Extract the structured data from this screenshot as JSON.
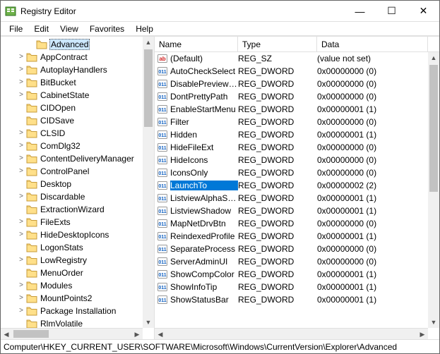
{
  "window": {
    "title": "Registry Editor"
  },
  "menu": {
    "file": "File",
    "edit": "Edit",
    "view": "View",
    "favorites": "Favorites",
    "help": "Help"
  },
  "tree": {
    "items": [
      {
        "indent": 2,
        "twist": "",
        "label": "Advanced",
        "selected": true
      },
      {
        "indent": 1,
        "twist": ">",
        "label": "AppContract"
      },
      {
        "indent": 1,
        "twist": ">",
        "label": "AutoplayHandlers"
      },
      {
        "indent": 1,
        "twist": ">",
        "label": "BitBucket"
      },
      {
        "indent": 1,
        "twist": ">",
        "label": "CabinetState"
      },
      {
        "indent": 1,
        "twist": "",
        "label": "CIDOpen"
      },
      {
        "indent": 1,
        "twist": "",
        "label": "CIDSave"
      },
      {
        "indent": 1,
        "twist": ">",
        "label": "CLSID"
      },
      {
        "indent": 1,
        "twist": ">",
        "label": "ComDlg32"
      },
      {
        "indent": 1,
        "twist": ">",
        "label": "ContentDeliveryManager"
      },
      {
        "indent": 1,
        "twist": ">",
        "label": "ControlPanel"
      },
      {
        "indent": 1,
        "twist": "",
        "label": "Desktop"
      },
      {
        "indent": 1,
        "twist": ">",
        "label": "Discardable"
      },
      {
        "indent": 1,
        "twist": "",
        "label": "ExtractionWizard"
      },
      {
        "indent": 1,
        "twist": ">",
        "label": "FileExts"
      },
      {
        "indent": 1,
        "twist": ">",
        "label": "HideDesktopIcons"
      },
      {
        "indent": 1,
        "twist": "",
        "label": "LogonStats"
      },
      {
        "indent": 1,
        "twist": ">",
        "label": "LowRegistry"
      },
      {
        "indent": 1,
        "twist": "",
        "label": "MenuOrder"
      },
      {
        "indent": 1,
        "twist": ">",
        "label": "Modules"
      },
      {
        "indent": 1,
        "twist": ">",
        "label": "MountPoints2"
      },
      {
        "indent": 1,
        "twist": ">",
        "label": "Package Installation"
      },
      {
        "indent": 1,
        "twist": "",
        "label": "RlmVolatile"
      }
    ]
  },
  "columns": {
    "name": "Name",
    "type": "Type",
    "data": "Data"
  },
  "values": [
    {
      "icon": "sz",
      "name": "(Default)",
      "type": "REG_SZ",
      "data": "(value not set)"
    },
    {
      "icon": "dw",
      "name": "AutoCheckSelect",
      "type": "REG_DWORD",
      "data": "0x00000000 (0)"
    },
    {
      "icon": "dw",
      "name": "DisablePreviewD...",
      "type": "REG_DWORD",
      "data": "0x00000000 (0)"
    },
    {
      "icon": "dw",
      "name": "DontPrettyPath",
      "type": "REG_DWORD",
      "data": "0x00000000 (0)"
    },
    {
      "icon": "dw",
      "name": "EnableStartMenu",
      "type": "REG_DWORD",
      "data": "0x00000001 (1)"
    },
    {
      "icon": "dw",
      "name": "Filter",
      "type": "REG_DWORD",
      "data": "0x00000000 (0)"
    },
    {
      "icon": "dw",
      "name": "Hidden",
      "type": "REG_DWORD",
      "data": "0x00000001 (1)"
    },
    {
      "icon": "dw",
      "name": "HideFileExt",
      "type": "REG_DWORD",
      "data": "0x00000000 (0)"
    },
    {
      "icon": "dw",
      "name": "HideIcons",
      "type": "REG_DWORD",
      "data": "0x00000000 (0)"
    },
    {
      "icon": "dw",
      "name": "IconsOnly",
      "type": "REG_DWORD",
      "data": "0x00000000 (0)"
    },
    {
      "icon": "dw",
      "name": "LaunchTo",
      "type": "REG_DWORD",
      "data": "0x00000002 (2)",
      "selected": true
    },
    {
      "icon": "dw",
      "name": "ListviewAlphaSe...",
      "type": "REG_DWORD",
      "data": "0x00000001 (1)"
    },
    {
      "icon": "dw",
      "name": "ListviewShadow",
      "type": "REG_DWORD",
      "data": "0x00000001 (1)"
    },
    {
      "icon": "dw",
      "name": "MapNetDrvBtn",
      "type": "REG_DWORD",
      "data": "0x00000000 (0)"
    },
    {
      "icon": "dw",
      "name": "ReindexedProfile",
      "type": "REG_DWORD",
      "data": "0x00000001 (1)"
    },
    {
      "icon": "dw",
      "name": "SeparateProcess",
      "type": "REG_DWORD",
      "data": "0x00000000 (0)"
    },
    {
      "icon": "dw",
      "name": "ServerAdminUI",
      "type": "REG_DWORD",
      "data": "0x00000000 (0)"
    },
    {
      "icon": "dw",
      "name": "ShowCompColor",
      "type": "REG_DWORD",
      "data": "0x00000001 (1)"
    },
    {
      "icon": "dw",
      "name": "ShowInfoTip",
      "type": "REG_DWORD",
      "data": "0x00000001 (1)"
    },
    {
      "icon": "dw",
      "name": "ShowStatusBar",
      "type": "REG_DWORD",
      "data": "0x00000001 (1)"
    }
  ],
  "statusbar": "Computer\\HKEY_CURRENT_USER\\SOFTWARE\\Microsoft\\Windows\\CurrentVersion\\Explorer\\Advanced"
}
